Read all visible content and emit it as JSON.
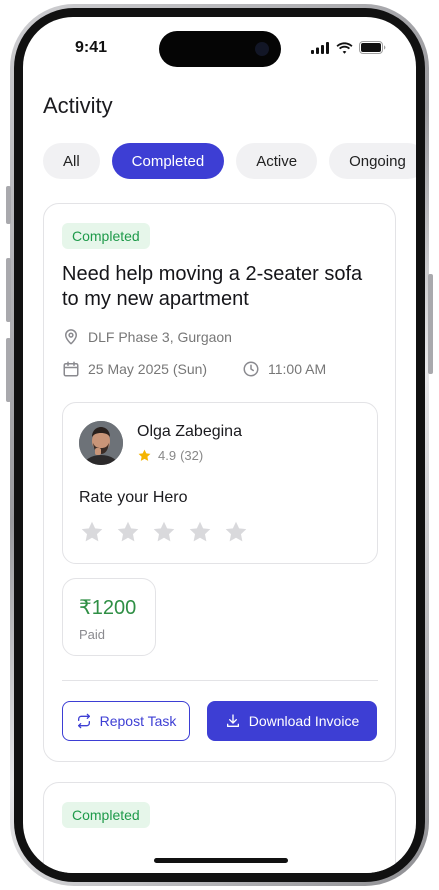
{
  "status_bar": {
    "time": "9:41"
  },
  "page": {
    "title": "Activity"
  },
  "filters": [
    {
      "label": "All"
    },
    {
      "label": "Completed"
    },
    {
      "label": "Active"
    },
    {
      "label": "Ongoing"
    }
  ],
  "selected_filter": "Completed",
  "task": {
    "status": "Completed",
    "title": "Need help moving a 2-seater sofa to my new apartment",
    "location": "DLF Phase 3, Gurgaon",
    "date": "25 May 2025 (Sun)",
    "time": "11:00 AM",
    "hero": {
      "name": "Olga Zabegina",
      "rating": "4.9",
      "reviews": "(32)",
      "rate_prompt": "Rate your Hero",
      "stars_filled": 0,
      "stars_total": 5
    },
    "price": "₹1200",
    "payment_status": "Paid",
    "repost_label": "Repost Task",
    "download_label": "Download Invoice"
  },
  "next_task": {
    "status": "Completed"
  },
  "colors": {
    "accent": "#3d3ed4",
    "success": "#1e9a4a",
    "success_bg": "#e6f6ea",
    "star_filled": "#f5b400",
    "star_empty": "#d9d9dc"
  }
}
